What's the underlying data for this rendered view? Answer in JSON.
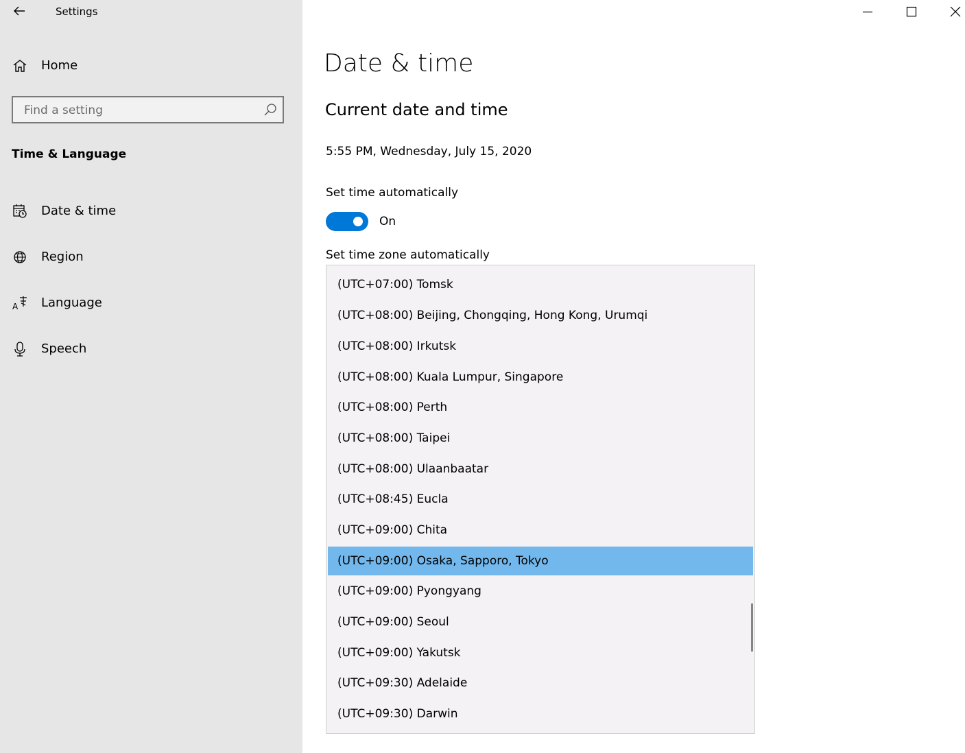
{
  "app": {
    "title": "Settings"
  },
  "window_controls": {
    "minimize": "minimize-icon",
    "maximize": "maximize-icon",
    "close": "close-icon"
  },
  "sidebar": {
    "home_label": "Home",
    "search": {
      "placeholder": "Find a setting",
      "value": ""
    },
    "section_title": "Time & Language",
    "items": [
      {
        "label": "Date & time",
        "icon": "calendar-clock-icon"
      },
      {
        "label": "Region",
        "icon": "globe-icon"
      },
      {
        "label": "Language",
        "icon": "language-icon"
      },
      {
        "label": "Speech",
        "icon": "microphone-icon"
      }
    ]
  },
  "main": {
    "title": "Date & time",
    "subheading": "Current date and time",
    "current_datetime": "5:55 PM, Wednesday, July 15, 2020",
    "set_time_auto": {
      "label": "Set time automatically",
      "state": "On",
      "on": true
    },
    "set_timezone_auto": {
      "label": "Set time zone automatically"
    }
  },
  "timezone_dropdown": {
    "selected": "(UTC+09:00) Osaka, Sapporo, Tokyo",
    "options": [
      "(UTC+07:00) Tomsk",
      "(UTC+08:00) Beijing, Chongqing, Hong Kong, Urumqi",
      "(UTC+08:00) Irkutsk",
      "(UTC+08:00) Kuala Lumpur, Singapore",
      "(UTC+08:00) Perth",
      "(UTC+08:00) Taipei",
      "(UTC+08:00) Ulaanbaatar",
      "(UTC+08:45) Eucla",
      "(UTC+09:00) Chita",
      "(UTC+09:00) Osaka, Sapporo, Tokyo",
      "(UTC+09:00) Pyongyang",
      "(UTC+09:00) Seoul",
      "(UTC+09:00) Yakutsk",
      "(UTC+09:30) Adelaide",
      "(UTC+09:30) Darwin"
    ]
  },
  "colors": {
    "sidebar_bg": "#e6e6e6",
    "accent": "#0078d7",
    "selection": "#73b8ed",
    "list_bg": "#f4f2f4"
  }
}
